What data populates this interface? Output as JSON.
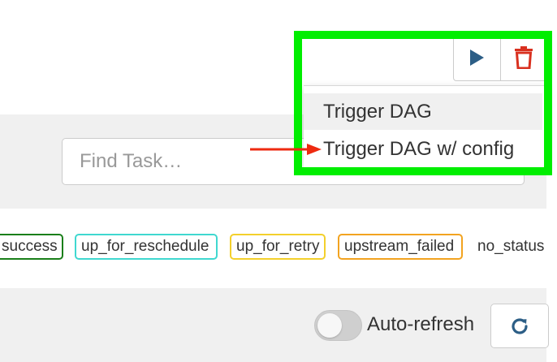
{
  "search": {
    "placeholder": "Find Task…"
  },
  "legend": {
    "success": "success",
    "up_for_reschedule": "up_for_reschedule",
    "up_for_retry": "up_for_retry",
    "upstream_failed": "upstream_failed",
    "no_status": "no_status"
  },
  "auto_refresh": {
    "label": "Auto-refresh",
    "enabled": false
  },
  "dag_actions": {
    "icons": [
      "play-icon",
      "trash-icon"
    ]
  },
  "trigger_menu": {
    "items": [
      {
        "label": "Trigger DAG"
      },
      {
        "label": "Trigger DAG w/ config"
      }
    ]
  },
  "colors": {
    "success": "#1a7f1a",
    "up_for_reschedule": "#40d8d0",
    "up_for_retry": "#f3d02c",
    "upstream_failed": "#f2a320",
    "highlight": "#00ee00",
    "arrow": "#ee2a10",
    "play_icon": "#2c5e86",
    "trash_icon": "#d9301f"
  }
}
